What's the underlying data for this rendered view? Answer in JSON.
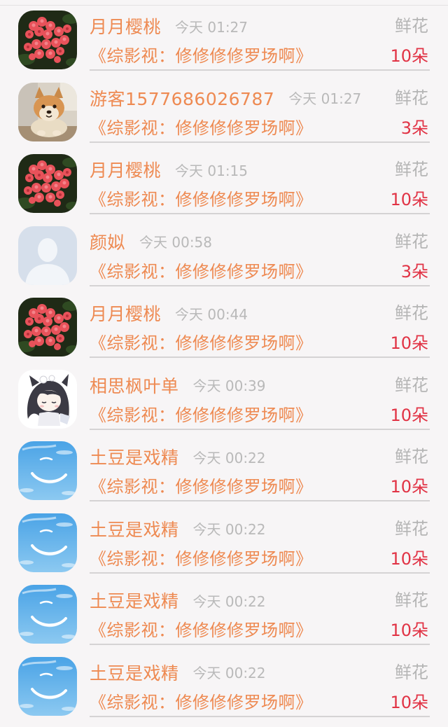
{
  "gifts": [
    {
      "avatar": "red-flower-avatar",
      "username": "月月樱桃",
      "time": "今天 01:27",
      "gift_type": "鲜花",
      "work": "《综影视：修修修修罗场啊》",
      "count": "10朵"
    },
    {
      "avatar": "shiba-dog-avatar",
      "username": "游客1577686026787",
      "time": "今天 01:27",
      "gift_type": "鲜花",
      "work": "《综影视：修修修修罗场啊》",
      "count": "3朵"
    },
    {
      "avatar": "red-flower-avatar",
      "username": "月月樱桃",
      "time": "今天 01:15",
      "gift_type": "鲜花",
      "work": "《综影视：修修修修罗场啊》",
      "count": "10朵"
    },
    {
      "avatar": "default-user-avatar",
      "username": "颜姒",
      "time": "今天 00:58",
      "gift_type": "鲜花",
      "work": "《综影视：修修修修罗场啊》",
      "count": "3朵"
    },
    {
      "avatar": "red-flower-avatar",
      "username": "月月樱桃",
      "time": "今天 00:44",
      "gift_type": "鲜花",
      "work": "《综影视：修修修修罗场啊》",
      "count": "10朵"
    },
    {
      "avatar": "anime-girl-avatar",
      "username": "相思枫叶单",
      "time": "今天 00:39",
      "gift_type": "鲜花",
      "work": "《综影视：修修修修罗场啊》",
      "count": "10朵"
    },
    {
      "avatar": "blue-sky-avatar",
      "username": "土豆是戏精",
      "time": "今天 00:22",
      "gift_type": "鲜花",
      "work": "《综影视：修修修修罗场啊》",
      "count": "10朵"
    },
    {
      "avatar": "blue-sky-avatar",
      "username": "土豆是戏精",
      "time": "今天 00:22",
      "gift_type": "鲜花",
      "work": "《综影视：修修修修罗场啊》",
      "count": "10朵"
    },
    {
      "avatar": "blue-sky-avatar",
      "username": "土豆是戏精",
      "time": "今天 00:22",
      "gift_type": "鲜花",
      "work": "《综影视：修修修修罗场啊》",
      "count": "10朵"
    },
    {
      "avatar": "blue-sky-avatar",
      "username": "土豆是戏精",
      "time": "今天 00:22",
      "gift_type": "鲜花",
      "work": "《综影视：修修修修罗场啊》",
      "count": "10朵"
    }
  ],
  "colors": {
    "username": "#ee8a52",
    "count": "#e13345",
    "muted": "#b9b9b9",
    "background": "#f7f5f6"
  }
}
